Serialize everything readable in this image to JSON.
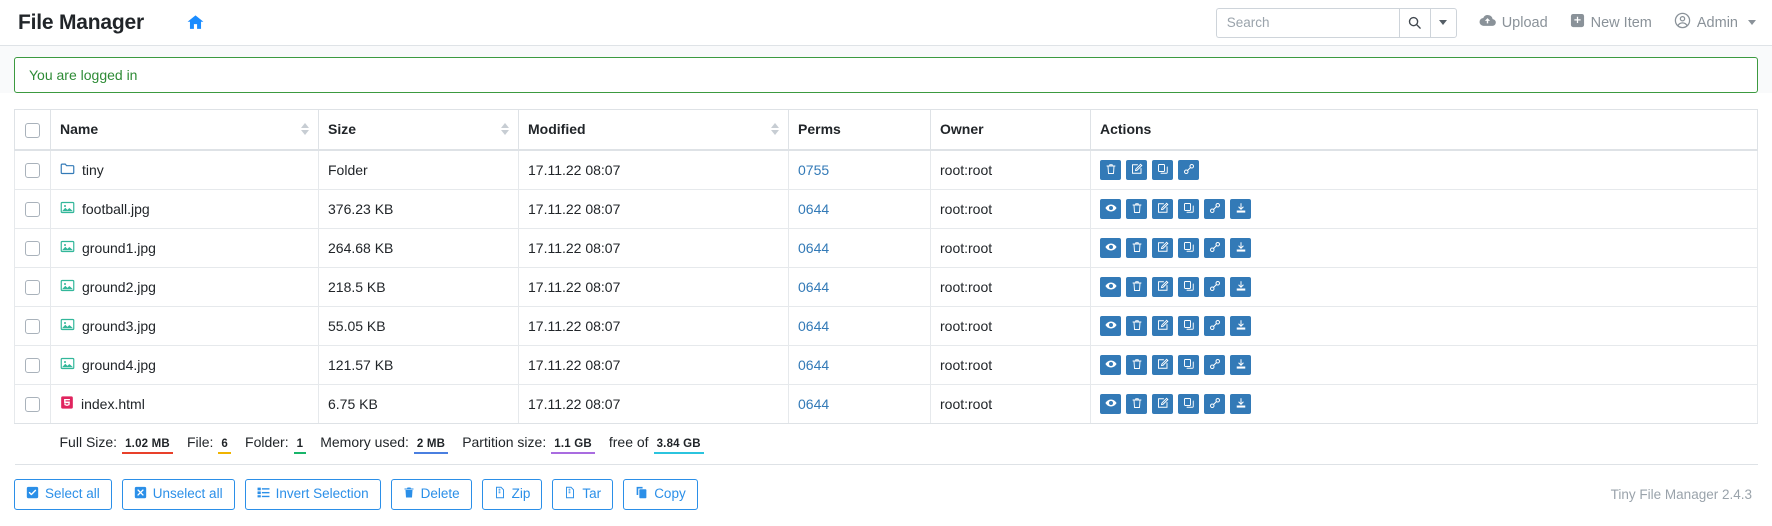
{
  "navbar": {
    "brand": "File Manager",
    "home_icon": "home-icon",
    "search": {
      "placeholder": "Search",
      "value": "",
      "search_icon": "search-icon",
      "caret_icon": "chevron-down-icon"
    },
    "links": [
      {
        "label": "Upload",
        "icon": "cloud-upload-icon"
      },
      {
        "label": "New Item",
        "icon": "plus-square-icon"
      },
      {
        "label": "Admin",
        "icon": "user-circle-icon",
        "caret": true
      }
    ]
  },
  "alert": {
    "message": "You are logged in",
    "border_color": "#3c9a40",
    "text_color": "#2e8b36"
  },
  "table": {
    "headers": [
      "Name",
      "Size",
      "Modified",
      "Perms",
      "Owner",
      "Actions"
    ],
    "rows": [
      {
        "name": "tiny",
        "icon": "folder-icon",
        "icon_color": "#337ab7",
        "size": "Folder",
        "modified": "17.11.22 08:07",
        "perms": "0755",
        "owner": "root:root",
        "actions": [
          "delete-icon",
          "rename-icon",
          "copy-icon",
          "link-icon"
        ]
      },
      {
        "name": "football.jpg",
        "icon": "image-icon",
        "icon_color": "#32b79a",
        "size": "376.23 KB",
        "modified": "17.11.22 08:07",
        "perms": "0644",
        "owner": "root:root",
        "actions": [
          "view-icon",
          "delete-icon",
          "rename-icon",
          "copy-icon",
          "link-icon",
          "download-icon"
        ]
      },
      {
        "name": "ground1.jpg",
        "icon": "image-icon",
        "icon_color": "#32b79a",
        "size": "264.68 KB",
        "modified": "17.11.22 08:07",
        "perms": "0644",
        "owner": "root:root",
        "actions": [
          "view-icon",
          "delete-icon",
          "rename-icon",
          "copy-icon",
          "link-icon",
          "download-icon"
        ]
      },
      {
        "name": "ground2.jpg",
        "icon": "image-icon",
        "icon_color": "#32b79a",
        "size": "218.5 KB",
        "modified": "17.11.22 08:07",
        "perms": "0644",
        "owner": "root:root",
        "actions": [
          "view-icon",
          "delete-icon",
          "rename-icon",
          "copy-icon",
          "link-icon",
          "download-icon"
        ]
      },
      {
        "name": "ground3.jpg",
        "icon": "image-icon",
        "icon_color": "#32b79a",
        "size": "55.05 KB",
        "modified": "17.11.22 08:07",
        "perms": "0644",
        "owner": "root:root",
        "actions": [
          "view-icon",
          "delete-icon",
          "rename-icon",
          "copy-icon",
          "link-icon",
          "download-icon"
        ]
      },
      {
        "name": "ground4.jpg",
        "icon": "image-icon",
        "icon_color": "#32b79a",
        "size": "121.57 KB",
        "modified": "17.11.22 08:07",
        "perms": "0644",
        "owner": "root:root",
        "actions": [
          "view-icon",
          "delete-icon",
          "rename-icon",
          "copy-icon",
          "link-icon",
          "download-icon"
        ]
      },
      {
        "name": "index.html",
        "icon": "html5-file-icon",
        "icon_color": "#e0245e",
        "size": "6.75 KB",
        "modified": "17.11.22 08:07",
        "perms": "0644",
        "owner": "root:root",
        "actions": [
          "view-icon",
          "delete-icon",
          "rename-icon",
          "copy-icon",
          "link-icon",
          "download-icon"
        ]
      }
    ]
  },
  "summary": {
    "full_size_label": "Full Size:",
    "full_size_value": "1.02 MB",
    "full_size_color": "#e8402a",
    "file_label": "File:",
    "file_value": "6",
    "file_color": "#f0b400",
    "folder_label": "Folder:",
    "folder_value": "1",
    "folder_color": "#18b56a",
    "memory_label": "Memory used:",
    "memory_value": "2 MB",
    "memory_color": "#4a7fe0",
    "partition_label": "Partition size:",
    "partition_value": "1.1 GB",
    "partition_color": "#a96ce0",
    "free_of_label": "free of",
    "free_of_value": "3.84 GB",
    "free_of_color": "#2bc4de"
  },
  "toolbar": {
    "buttons": [
      {
        "label": "Select all",
        "icon": "check-square-icon"
      },
      {
        "label": "Unselect all",
        "icon": "x-square-icon"
      },
      {
        "label": "Invert Selection",
        "icon": "list-icon"
      },
      {
        "label": "Delete",
        "icon": "trash-icon"
      },
      {
        "label": "Zip",
        "icon": "file-archive-icon"
      },
      {
        "label": "Tar",
        "icon": "file-archive-icon"
      },
      {
        "label": "Copy",
        "icon": "copy-icon"
      }
    ],
    "version": "Tiny File Manager 2.4.3"
  },
  "colors": {
    "primary": "#337ab7",
    "toolbar_blue": "#2b8fe8",
    "muted": "#8a9299"
  }
}
